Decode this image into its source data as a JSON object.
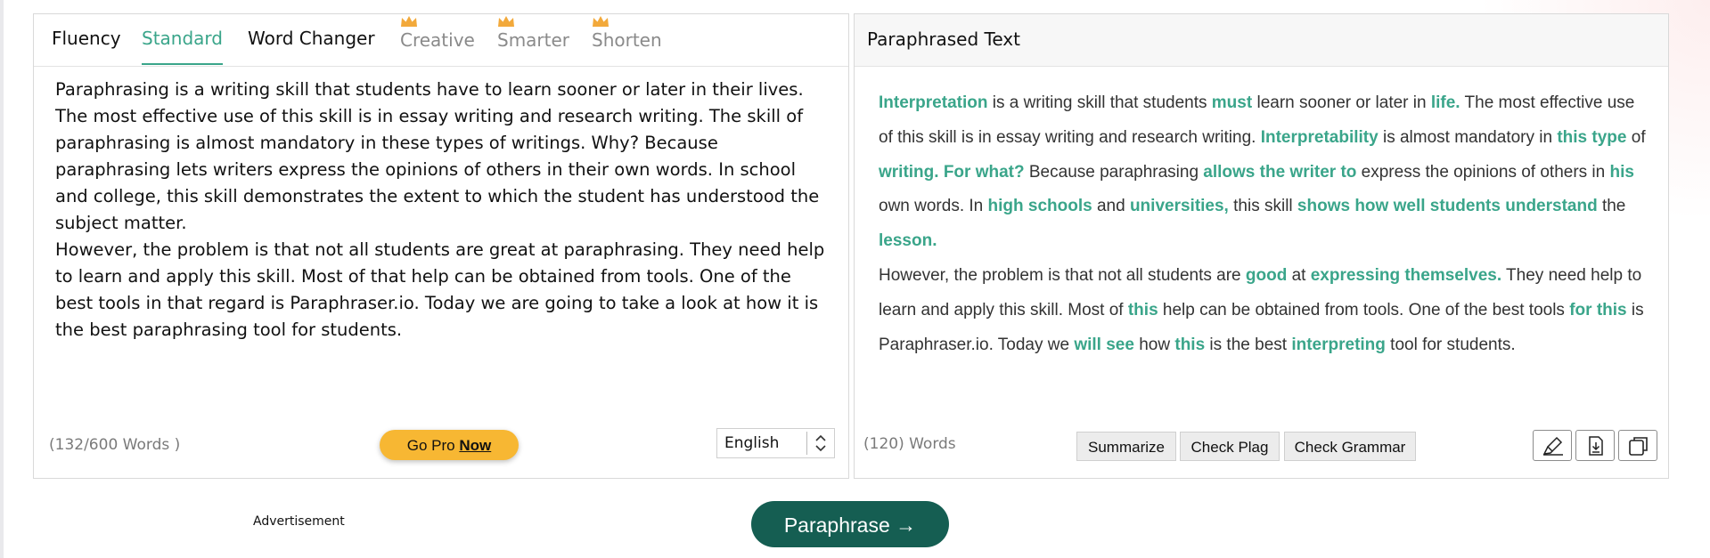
{
  "tabs": [
    {
      "label": "Fluency",
      "state": "normal",
      "pro": false
    },
    {
      "label": "Standard",
      "state": "active",
      "pro": false
    },
    {
      "label": "Word Changer",
      "state": "normal",
      "pro": false
    },
    {
      "label": "Creative",
      "state": "locked",
      "pro": true
    },
    {
      "label": "Smarter",
      "state": "locked",
      "pro": true
    },
    {
      "label": "Shorten",
      "state": "locked",
      "pro": true
    }
  ],
  "input": {
    "paragraphs": [
      "Paraphrasing is a writing skill that students have to learn sooner or later in their lives. The most effective use of this skill is in essay writing and research writing. The skill of paraphrasing is almost mandatory in these types of writings. Why? Because paraphrasing lets writers express the opinions of others in their own words. In school and college, this skill demonstrates the extent to which the student has understood the subject matter.",
      "However, the problem is that not all students are great at paraphrasing. They need help to learn and apply this skill. Most of that help can be obtained from tools. One of the best tools in that regard is Paraphraser.io. Today we are going to take a look at how it is the best paraphrasing tool for students."
    ],
    "word_count": "(132/600 Words )"
  },
  "go_pro": {
    "prefix": "Go Pro ",
    "bold": "Now"
  },
  "language": {
    "selected": "English"
  },
  "output": {
    "title": "Paraphrased Text",
    "paragraphs": [
      [
        {
          "t": "Interpretation",
          "c": true
        },
        {
          "t": " is a writing skill that students ",
          "c": false
        },
        {
          "t": "must",
          "c": true
        },
        {
          "t": " learn sooner or later in ",
          "c": false
        },
        {
          "t": "life.",
          "c": true
        },
        {
          "t": " The most effective use of this skill is in essay writing and research writing. ",
          "c": false
        },
        {
          "t": "Interpretability",
          "c": true
        },
        {
          "t": " is almost mandatory in ",
          "c": false
        },
        {
          "t": "this type",
          "c": true
        },
        {
          "t": " of ",
          "c": false
        },
        {
          "t": "writing. For what?",
          "c": true
        },
        {
          "t": " Because paraphrasing ",
          "c": false
        },
        {
          "t": "allows the writer to",
          "c": true
        },
        {
          "t": " express the opinions of others in ",
          "c": false
        },
        {
          "t": "his",
          "c": true
        },
        {
          "t": " own words. In ",
          "c": false
        },
        {
          "t": "high schools",
          "c": true
        },
        {
          "t": " and ",
          "c": false
        },
        {
          "t": "universities,",
          "c": true
        },
        {
          "t": " this skill ",
          "c": false
        },
        {
          "t": "shows how well students understand",
          "c": true
        },
        {
          "t": " the ",
          "c": false
        },
        {
          "t": "lesson.",
          "c": true
        }
      ],
      [
        {
          "t": "However, the problem is that not all students are ",
          "c": false
        },
        {
          "t": "good",
          "c": true
        },
        {
          "t": " at ",
          "c": false
        },
        {
          "t": "expressing themselves.",
          "c": true
        },
        {
          "t": " They need help to learn and apply this skill. Most of ",
          "c": false
        },
        {
          "t": "this",
          "c": true
        },
        {
          "t": " help can be obtained from tools. One of the best tools ",
          "c": false
        },
        {
          "t": "for this",
          "c": true
        },
        {
          "t": " is Paraphraser.io. Today we ",
          "c": false
        },
        {
          "t": "will see",
          "c": true
        },
        {
          "t": " how ",
          "c": false
        },
        {
          "t": "this",
          "c": true
        },
        {
          "t": " is the best ",
          "c": false
        },
        {
          "t": "interpreting",
          "c": true
        },
        {
          "t": " tool for students.",
          "c": false
        }
      ]
    ],
    "word_count": "(120) Words"
  },
  "actions": {
    "summarize": "Summarize",
    "check_plag": "Check Plag",
    "check_grammar": "Check Grammar"
  },
  "icons": {
    "highlighter": "highlighter-icon",
    "download": "download-icon",
    "copy": "copy-icon",
    "crown": "crown-icon"
  },
  "advertisement": "Advertisement",
  "paraphrase_button": "Paraphrase →",
  "colors": {
    "accent": "#3aa58a",
    "primary_button": "#155e52",
    "go_pro": "#f7b733",
    "crown": "#f2a93b"
  }
}
